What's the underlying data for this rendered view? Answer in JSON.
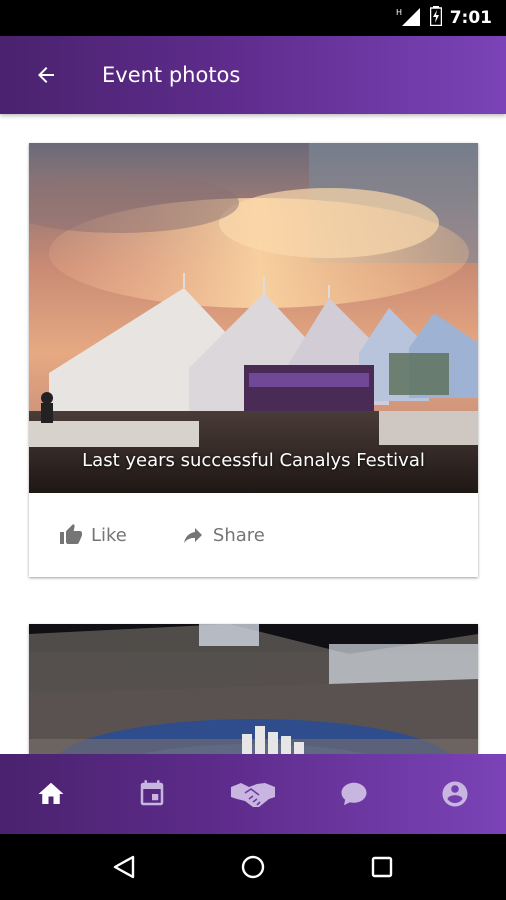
{
  "status_bar": {
    "time": "7:01",
    "signal_label": "H"
  },
  "app_bar": {
    "title": "Event photos"
  },
  "posts": [
    {
      "caption": "Last years successful Canalys Festival",
      "like_label": "Like",
      "share_label": "Share"
    },
    {
      "caption": ""
    }
  ],
  "bottom_nav": [
    "home-icon",
    "calendar-icon",
    "handshake-icon",
    "chat-icon",
    "account-icon"
  ],
  "colors": {
    "accent_dark": "#4a226e",
    "accent_light": "#7b43b7",
    "action_gray": "#757575"
  }
}
